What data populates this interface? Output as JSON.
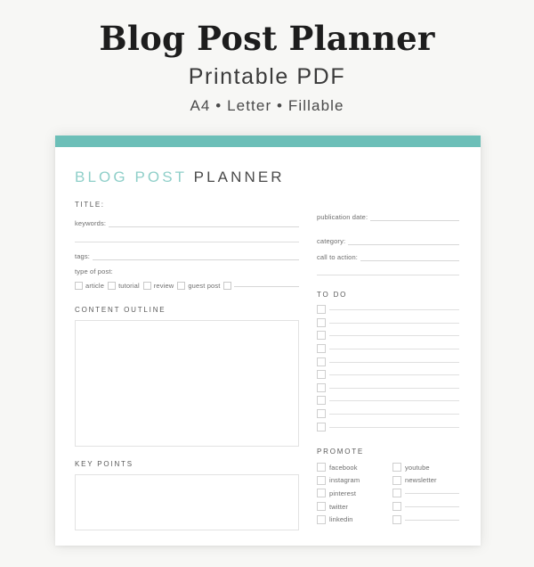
{
  "promo": {
    "title": "Blog Post Planner",
    "subtitle": "Printable PDF",
    "formats": "A4 • Letter • Fillable"
  },
  "sheet": {
    "accent_bar_color": "#6cbfb8",
    "heading_teal_text": "BLOG POST",
    "heading_dark_text": " PLANNER",
    "heading_teal_color": "#8fcfc9",
    "heading_dark_color": "#4a4a4a"
  },
  "form": {
    "title_label": "TITLE:",
    "keywords_label": "keywords:",
    "tags_label": "tags:",
    "type_of_post_label": "type of post:",
    "type_options": [
      "article",
      "tutorial",
      "review",
      "guest post"
    ],
    "publication_date_label": "publication date:",
    "category_label": "category:",
    "call_to_action_label": "call to action:"
  },
  "sections": {
    "content_outline": "CONTENT OUTLINE",
    "to_do": "TO DO",
    "key_points": "KEY POINTS",
    "promote": "PROMOTE"
  },
  "todo": {
    "row_count": 10
  },
  "promote": {
    "column_one": [
      "facebook",
      "instagram",
      "pinterest",
      "twitter",
      "linkedin"
    ],
    "column_two": [
      "youtube",
      "newsletter",
      "",
      "",
      ""
    ]
  }
}
